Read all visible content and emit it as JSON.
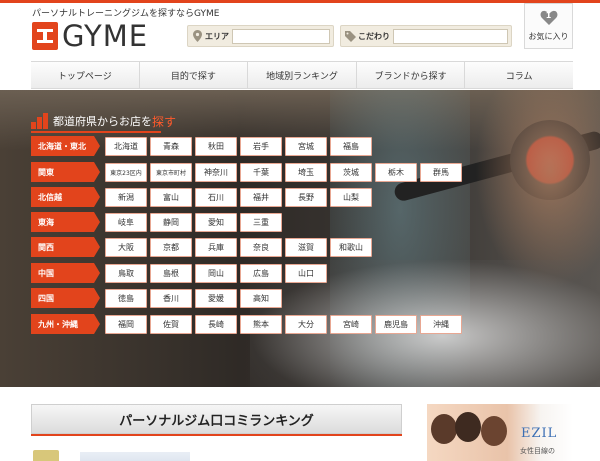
{
  "header": {
    "tagline": "パーソナルトレーニングジムを探すならGYME",
    "logo_text": "GYME",
    "search_area": {
      "label": "エリア",
      "value": "",
      "placeholder": ""
    },
    "search_kodawari": {
      "label": "こだわり",
      "value": "",
      "placeholder": ""
    },
    "favorites": {
      "count": "1",
      "label": "お気に入り"
    }
  },
  "nav": {
    "items": [
      "トップページ",
      "目的で探す",
      "地域別ランキング",
      "ブランドから探す",
      "コラム"
    ]
  },
  "hero": {
    "title_prefix": "都道府県からお店を",
    "title_highlight": "探す",
    "regions": [
      {
        "label": "北海道・東北",
        "prefs": [
          "北海道",
          "青森",
          "秋田",
          "岩手",
          "宮城",
          "福島"
        ]
      },
      {
        "label": "関東",
        "prefs": [
          "東京23区内",
          "東京市町村",
          "神奈川",
          "千葉",
          "埼玉",
          "茨城",
          "栃木",
          "群馬"
        ]
      },
      {
        "label": "北信越",
        "prefs": [
          "新潟",
          "富山",
          "石川",
          "福井",
          "長野",
          "山梨"
        ]
      },
      {
        "label": "東海",
        "prefs": [
          "岐阜",
          "静岡",
          "愛知",
          "三重"
        ]
      },
      {
        "label": "関西",
        "prefs": [
          "大阪",
          "京都",
          "兵庫",
          "奈良",
          "滋賀",
          "和歌山"
        ]
      },
      {
        "label": "中国",
        "prefs": [
          "鳥取",
          "島根",
          "岡山",
          "広島",
          "山口"
        ]
      },
      {
        "label": "四国",
        "prefs": [
          "徳島",
          "香川",
          "愛媛",
          "高知"
        ]
      },
      {
        "label": "九州・沖縄",
        "prefs": [
          "福岡",
          "佐賀",
          "長崎",
          "熊本",
          "大分",
          "宮崎",
          "鹿児島",
          "沖縄"
        ]
      }
    ]
  },
  "ranking": {
    "title": "パーソナルジム口コミランキング"
  },
  "ad": {
    "brand": "EZIL",
    "sub": "女性目線の"
  },
  "colors": {
    "accent": "#e2441c",
    "search_bg": "#f1ece0"
  }
}
